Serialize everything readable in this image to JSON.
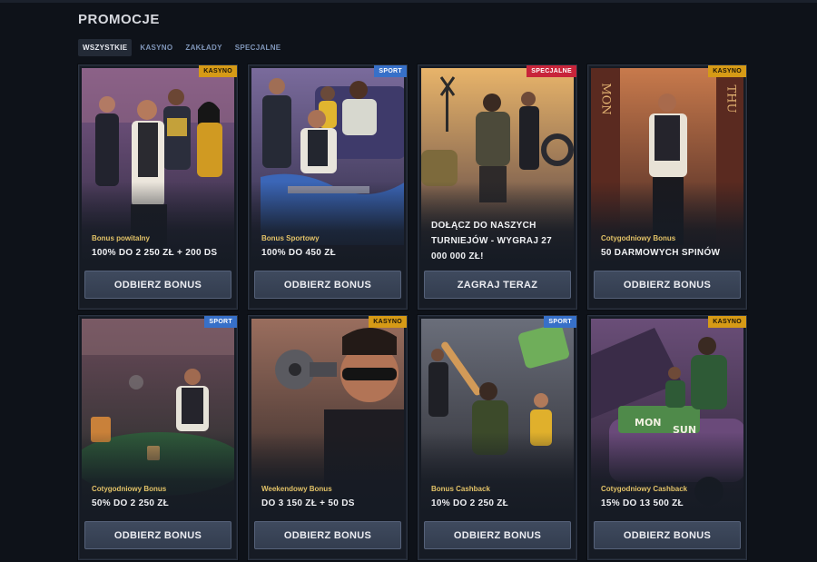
{
  "page": {
    "title": "PROMOCJE"
  },
  "tabs": [
    {
      "label": "WSZYSTKIE",
      "active": true
    },
    {
      "label": "KASYNO",
      "active": false
    },
    {
      "label": "ZAKŁADY",
      "active": false
    },
    {
      "label": "SPECJALNE",
      "active": false
    }
  ],
  "cards": [
    {
      "badge": "KASYNO",
      "badge_type": "kasyno",
      "subtitle": "Bonus powitalny",
      "offer": "100% DO 2 250 ZŁ + 200 DS",
      "button": "ODBIERZ BONUS",
      "art": "gang-group"
    },
    {
      "badge": "SPORT",
      "badge_type": "sport",
      "subtitle": "Bonus Sportowy",
      "offer": "100% DO 450 ZŁ",
      "button": "ODBIERZ BONUS",
      "art": "sofa-gang"
    },
    {
      "badge": "SPECJALNE",
      "badge_type": "specjalne",
      "subtitle": "",
      "offer": "DOŁĄCZ DO NASZYCH TURNIEJÓW - WYGRAJ 27 000 000 ZŁ!",
      "button": "ZAGRAJ TERAZ",
      "art": "handshake-cars"
    },
    {
      "badge": "KASYNO",
      "badge_type": "kasyno",
      "subtitle": "Cotygodniowy Bonus",
      "offer": "50 DARMOWYCH SPINÓW",
      "button": "ODBIERZ BONUS",
      "art": "door-mon-thu"
    },
    {
      "badge": "SPORT",
      "badge_type": "sport",
      "subtitle": "Cotygodniowy Bonus",
      "offer": "50% DO 2 250 ZŁ",
      "button": "ODBIERZ BONUS",
      "art": "poker-table"
    },
    {
      "badge": "KASYNO",
      "badge_type": "kasyno",
      "subtitle": "Weekendowy Bonus",
      "offer": "DO 3 150 ZŁ + 50 DS",
      "button": "ODBIERZ BONUS",
      "art": "revolver-man"
    },
    {
      "badge": "SPORT",
      "badge_type": "sport",
      "subtitle": "Bonus Cashback",
      "offer": "10% DO 2 250 ZŁ",
      "button": "ODBIERZ BONUS",
      "art": "baseball-cash"
    },
    {
      "badge": "KASYNO",
      "badge_type": "kasyno",
      "subtitle": "Cotygodniowy Cashback",
      "offer": "15% DO 13 500 ZŁ",
      "button": "ODBIERZ BONUS",
      "art": "car-trunk-money"
    }
  ],
  "art_labels": {
    "door_left": "MON",
    "door_right": "THU",
    "trunk_left": "MON",
    "trunk_right": "SUN"
  },
  "colors": {
    "kasyno": "#d69a16",
    "sport": "#3770c8",
    "specjalne": "#c8243a",
    "subtitle": "#e2c267"
  }
}
